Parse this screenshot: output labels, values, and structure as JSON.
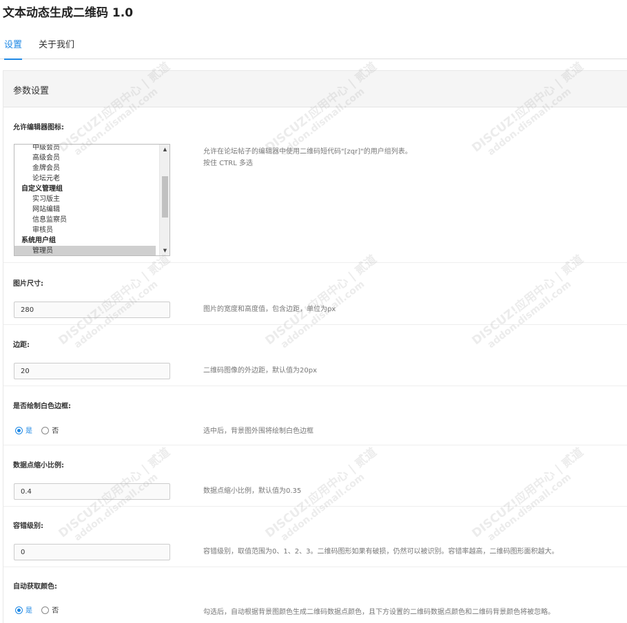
{
  "app": {
    "title": "文本动态生成二维码 1.0"
  },
  "tabs": [
    {
      "label": "设置",
      "active": true
    },
    {
      "label": "关于我们",
      "active": false
    }
  ],
  "panel": {
    "title": "参数设置"
  },
  "settings": {
    "editor_icon": {
      "label": "允许编辑器图标:",
      "desc_line1": "允许在论坛帖子的编辑器中使用二维码短代码\"[zqr]\"的用户组列表。",
      "desc_line2": "按住 CTRL 多选",
      "options": [
        {
          "text": "中级会员",
          "kind": "child",
          "selected": false
        },
        {
          "text": "高级会员",
          "kind": "child",
          "selected": false
        },
        {
          "text": "金牌会员",
          "kind": "child",
          "selected": false
        },
        {
          "text": "论坛元老",
          "kind": "child",
          "selected": false
        },
        {
          "text": "自定义管理组",
          "kind": "group",
          "selected": false
        },
        {
          "text": "实习版主",
          "kind": "child",
          "selected": false
        },
        {
          "text": "网站编辑",
          "kind": "child",
          "selected": false
        },
        {
          "text": "信息监察员",
          "kind": "child",
          "selected": false
        },
        {
          "text": "审核员",
          "kind": "child",
          "selected": false
        },
        {
          "text": "系统用户组",
          "kind": "group",
          "selected": false
        },
        {
          "text": "管理员",
          "kind": "child",
          "selected": true
        }
      ]
    },
    "image_size": {
      "label": "图片尺寸:",
      "value": "280",
      "desc": "图片的宽度和高度值，包含边距，单位为px"
    },
    "margin": {
      "label": "边距:",
      "value": "20",
      "desc": "二维码图像的外边距，默认值为20px"
    },
    "white_border": {
      "label": "是否绘制白色边框:",
      "option_yes": "是",
      "option_no": "否",
      "selected": "yes",
      "desc": "选中后，背景图外围将绘制白色边框"
    },
    "dot_scale": {
      "label": "数据点缩小比例:",
      "value": "0.4",
      "desc": "数据点缩小比例，默认值为0.35"
    },
    "error_level": {
      "label": "容错级别:",
      "value": "0",
      "desc": "容错级别，取值范围为0、1、2、3。二维码图形如果有破损，仍然可以被识别。容错率越高，二维码图形面积越大。"
    },
    "auto_color": {
      "label": "自动获取颜色:",
      "option_yes": "是",
      "option_no": "否",
      "selected": "yes",
      "desc": "勾选后，自动根据背景图颜色生成二维码数据点颜色，且下方设置的二维码数据点颜色和二维码背景颜色将被忽略。"
    }
  },
  "watermark": {
    "line1": "DISCUZ!应用中心 | 贰道",
    "line2": "addon.dismall.com"
  },
  "colors": {
    "accent": "#1e88e5",
    "header_bg": "#f5f5f5"
  }
}
